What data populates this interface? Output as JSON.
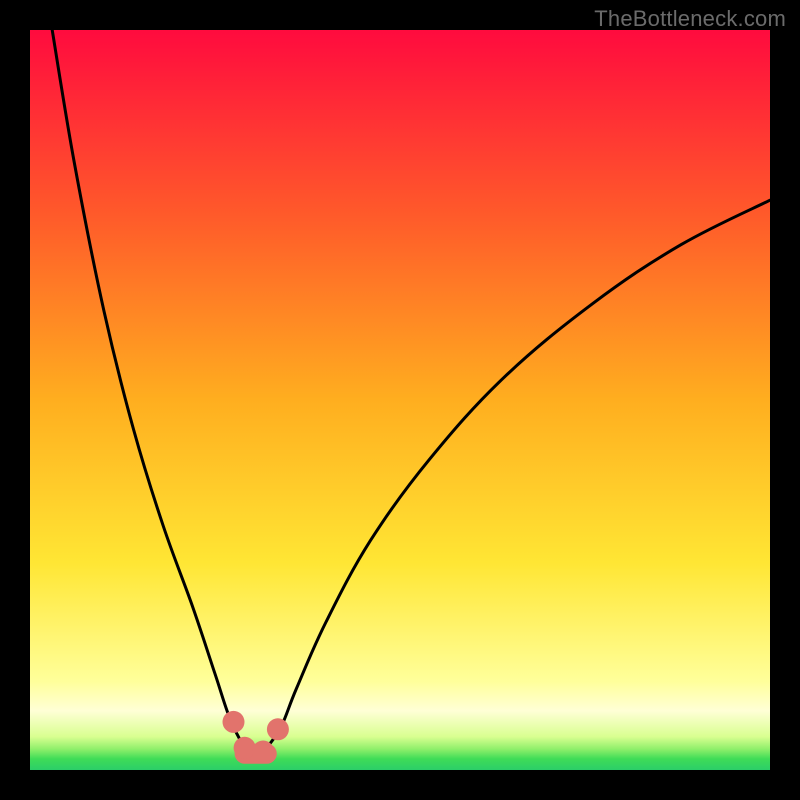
{
  "watermark": "TheBottleneck.com",
  "chart_data": {
    "type": "line",
    "title": "",
    "xlabel": "",
    "ylabel": "",
    "x_range": [
      0,
      100
    ],
    "y_range": [
      0,
      100
    ],
    "grid": false,
    "legend": false,
    "background_gradient": {
      "description": "Vertical gradient from red (top) through orange and yellow to light-yellow, with a narrow green band at the very bottom, rendered inside a thick black frame.",
      "stops": [
        {
          "offset": 0.0,
          "color": "#ff0b3e"
        },
        {
          "offset": 0.25,
          "color": "#ff5a2a"
        },
        {
          "offset": 0.5,
          "color": "#ffae1f"
        },
        {
          "offset": 0.72,
          "color": "#ffe634"
        },
        {
          "offset": 0.88,
          "color": "#ffff9a"
        },
        {
          "offset": 0.92,
          "color": "#ffffd6"
        },
        {
          "offset": 0.955,
          "color": "#d9ff90"
        },
        {
          "offset": 0.972,
          "color": "#8def6a"
        },
        {
          "offset": 0.985,
          "color": "#3fdc57"
        },
        {
          "offset": 1.0,
          "color": "#2bce69"
        }
      ]
    },
    "series": [
      {
        "name": "bottleneck-curve",
        "description": "V-shaped black curve with minimum near x≈30; left branch rises steeply to y≈100 at x≈3; right branch rises gradually to y≈77 at x=100.",
        "x": [
          3,
          6,
          10,
          14,
          18,
          22,
          25,
          27,
          29,
          30,
          31,
          32,
          34,
          36,
          40,
          46,
          54,
          64,
          76,
          88,
          100
        ],
        "y": [
          100,
          82,
          62,
          46,
          33,
          22,
          13,
          7,
          3,
          2,
          2,
          3,
          6,
          11,
          20,
          31,
          42,
          53,
          63,
          71,
          77
        ]
      },
      {
        "name": "highlight-markers",
        "description": "Salmon-colored rounded markers and a short thick segment emphasising the trough of the curve.",
        "points": [
          {
            "x": 27.5,
            "y": 6.5
          },
          {
            "x": 29.0,
            "y": 3.0
          },
          {
            "x": 31.5,
            "y": 2.5
          },
          {
            "x": 33.5,
            "y": 5.5
          }
        ],
        "segment": {
          "x1": 29.0,
          "y1": 2.2,
          "x2": 32.0,
          "y2": 2.2
        }
      }
    ]
  }
}
